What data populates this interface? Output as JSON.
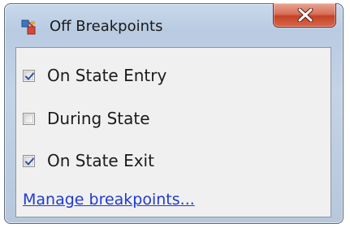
{
  "window": {
    "title": "Off Breakpoints",
    "icon": "breakpoint-app-icon",
    "close_icon": "close-icon"
  },
  "options": [
    {
      "label": "On State Entry",
      "checked": true
    },
    {
      "label": "During State",
      "checked": false
    },
    {
      "label": "On State Exit",
      "checked": true
    }
  ],
  "link": {
    "label": "Manage breakpoints..."
  },
  "colors": {
    "link": "#1f3bd0",
    "close_button": "#c44327",
    "check_mark": "#2d4fa6"
  }
}
